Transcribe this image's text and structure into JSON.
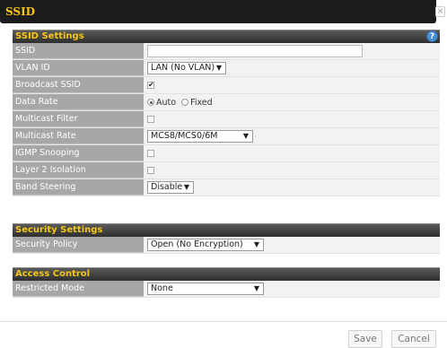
{
  "dialog": {
    "title": "SSID",
    "close_glyph": "×"
  },
  "ssid_settings": {
    "header": "SSID Settings",
    "help_glyph": "?",
    "rows": {
      "ssid": {
        "label": "SSID",
        "value": ""
      },
      "vlan_id": {
        "label": "VLAN ID",
        "value": "LAN (No VLAN)"
      },
      "broadcast_ssid": {
        "label": "Broadcast SSID",
        "checked": true
      },
      "data_rate": {
        "label": "Data Rate",
        "option_auto": "Auto",
        "option_fixed": "Fixed",
        "selected": "Auto"
      },
      "multicast_filter": {
        "label": "Multicast Filter",
        "checked": false
      },
      "multicast_rate": {
        "label": "Multicast Rate",
        "value": "MCS8/MCS0/6M"
      },
      "igmp_snooping": {
        "label": "IGMP Snooping",
        "checked": false
      },
      "layer2_isolation": {
        "label": "Layer 2 Isolation",
        "checked": false
      },
      "band_steering": {
        "label": "Band Steering",
        "value": "Disable"
      }
    }
  },
  "security_settings": {
    "header": "Security Settings",
    "security_policy": {
      "label": "Security Policy",
      "value": "Open (No Encryption)"
    }
  },
  "access_control": {
    "header": "Access Control",
    "restricted_mode": {
      "label": "Restricted Mode",
      "value": "None"
    }
  },
  "footer": {
    "save_label": "Save",
    "cancel_label": "Cancel"
  },
  "glyphs": {
    "dropdown_arrow": "▼",
    "check": "✔"
  },
  "colors": {
    "title_bar": "#1c1c1c",
    "accent_yellow": "#f5c518",
    "label_bg": "#a7a7a7",
    "help_blue": "#4a8fd4"
  }
}
